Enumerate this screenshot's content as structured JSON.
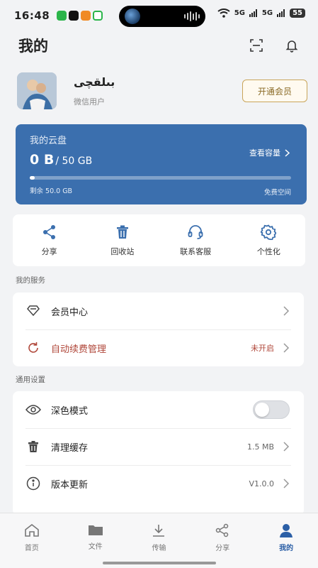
{
  "status_bar": {
    "time": "16:48",
    "signal1": "5G",
    "signal2": "5G",
    "battery": "55"
  },
  "header": {
    "title": "我的",
    "icons": [
      "scan-icon",
      "bell-icon"
    ]
  },
  "profile": {
    "username": "بىلقچى",
    "user_type": "微信用户",
    "vip_button": "开通会员"
  },
  "cloud": {
    "title": "我的云盘",
    "used": "0 B",
    "total": "/ 50 GB",
    "view_capacity": "查看容量",
    "remaining": "剩余 50.0 GB",
    "free_space": "免费空间",
    "used_fraction": 0.02
  },
  "tools": [
    {
      "label": "分享",
      "icon": "share-icon"
    },
    {
      "label": "回收站",
      "icon": "trash-icon"
    },
    {
      "label": "联系客服",
      "icon": "headset-icon"
    },
    {
      "label": "个性化",
      "icon": "gear-icon"
    }
  ],
  "services": {
    "title": "我的服务",
    "items": [
      {
        "label": "会员中心",
        "value": "",
        "icon": "diamond-icon"
      },
      {
        "label": "自动续费管理",
        "value": "未开启",
        "icon": "refresh-icon"
      }
    ]
  },
  "settings": {
    "title": "通用设置",
    "items": [
      {
        "label": "深色模式",
        "value": "",
        "icon": "eye-icon",
        "toggle": false
      },
      {
        "label": "清理缓存",
        "value": "1.5 MB",
        "icon": "clean-icon"
      },
      {
        "label": "版本更新",
        "value": "V1.0.0",
        "icon": "info-icon"
      }
    ]
  },
  "tab_bar": [
    {
      "label": "首页",
      "icon": "home-icon",
      "active": false
    },
    {
      "label": "文件",
      "icon": "folder-icon",
      "active": false
    },
    {
      "label": "传输",
      "icon": "download-icon",
      "active": false
    },
    {
      "label": "分享",
      "icon": "share-icon",
      "active": false
    },
    {
      "label": "我的",
      "icon": "person-icon",
      "active": true
    }
  ],
  "colors": {
    "accent": "#3b6fae",
    "vip": "#c9a55a",
    "renew": "#b0473a"
  }
}
